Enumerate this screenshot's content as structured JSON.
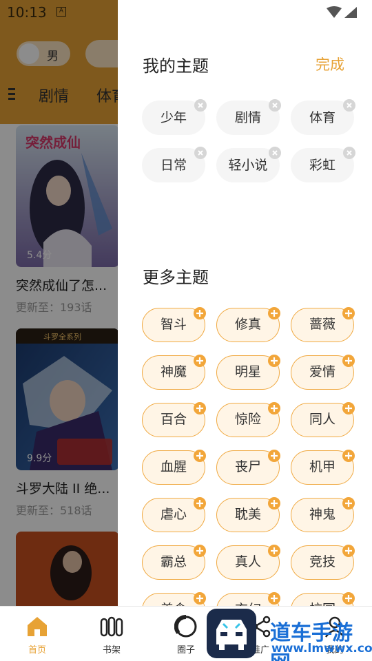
{
  "status_bar": {
    "time": "10:13",
    "notif_glyph": "A"
  },
  "header": {
    "gender_label": "男",
    "category_tabs": [
      "剧情",
      "体育"
    ]
  },
  "cards": [
    {
      "title": "突然成仙了怎...",
      "update": "更新至：193话",
      "score": "5.4分",
      "cover_text": "突然成仙了怎么办？"
    },
    {
      "title": "斗罗大陆 II 绝...",
      "update": "更新至：518话",
      "score": "9.9分",
      "cover_text": "斗罗大陆"
    },
    {
      "title": "",
      "update": "",
      "score": "",
      "cover_text": ""
    }
  ],
  "drawer": {
    "my_topics_title": "我的主题",
    "done_label": "完成",
    "my_topics": [
      "少年",
      "剧情",
      "体育",
      "日常",
      "轻小说",
      "彩虹"
    ],
    "more_topics_title": "更多主题",
    "more_topics": [
      "智斗",
      "修真",
      "蔷薇",
      "神魔",
      "明星",
      "爱情",
      "百合",
      "惊险",
      "同人",
      "血腥",
      "丧尸",
      "机甲",
      "虐心",
      "耽美",
      "神鬼",
      "霸总",
      "真人",
      "竞技",
      "美食",
      "玄幻",
      "校园"
    ]
  },
  "bottom_nav": [
    {
      "label": "首页",
      "icon": "home-icon",
      "active": true
    },
    {
      "label": "书架",
      "icon": "bookshelf-icon",
      "active": false
    },
    {
      "label": "圈子",
      "icon": "circle-icon",
      "active": false
    },
    {
      "label": "推广",
      "icon": "share-icon",
      "active": false
    },
    {
      "label": "我的",
      "icon": "profile-icon",
      "active": false
    }
  ],
  "watermark": {
    "text": "道车手游网",
    "url": "www.lmwwx.com"
  },
  "colors": {
    "accent": "#e7a235",
    "chip_border": "#f0a941",
    "watermark": "#1a6fd6"
  }
}
